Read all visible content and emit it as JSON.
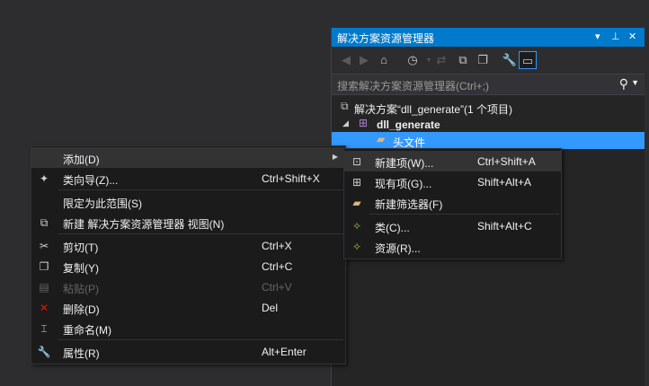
{
  "solution_explorer": {
    "title": "解决方案资源管理器",
    "title_controls": [
      "▾",
      "⊥",
      "✕"
    ],
    "search_placeholder": "搜索解决方案资源管理器(Ctrl+;)",
    "tree": {
      "solution_label": "解决方案“dll_generate”(1 个项目)",
      "project_label": "dll_generate",
      "folder_label": "头文件"
    }
  },
  "context_menu": {
    "items": [
      {
        "label": "添加(D)",
        "shortcut": ""
      },
      {
        "label": "类向导(Z)...",
        "shortcut": "Ctrl+Shift+X"
      },
      {
        "label": "限定为此范围(S)",
        "shortcut": ""
      },
      {
        "label": "新建 解决方案资源管理器 视图(N)",
        "shortcut": ""
      },
      {
        "label": "剪切(T)",
        "shortcut": "Ctrl+X"
      },
      {
        "label": "复制(Y)",
        "shortcut": "Ctrl+C"
      },
      {
        "label": "粘贴(P)",
        "shortcut": "Ctrl+V"
      },
      {
        "label": "删除(D)",
        "shortcut": "Del"
      },
      {
        "label": "重命名(M)",
        "shortcut": ""
      },
      {
        "label": "属性(R)",
        "shortcut": "Alt+Enter"
      }
    ]
  },
  "submenu": {
    "items": [
      {
        "label": "新建项(W)...",
        "shortcut": "Ctrl+Shift+A"
      },
      {
        "label": "现有项(G)...",
        "shortcut": "Shift+Alt+A"
      },
      {
        "label": "新建筛选器(F)",
        "shortcut": ""
      },
      {
        "label": "类(C)...",
        "shortcut": "Shift+Alt+C"
      },
      {
        "label": "资源(R)...",
        "shortcut": ""
      }
    ]
  },
  "colors": {
    "accent": "#007acc",
    "selection": "#3399ff",
    "menu_bg": "#1b1b1c",
    "background": "#2d2d30"
  }
}
